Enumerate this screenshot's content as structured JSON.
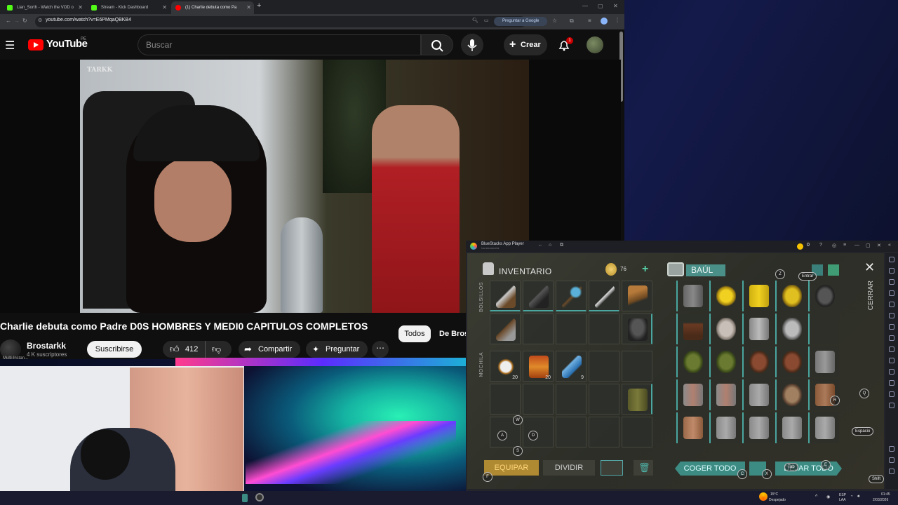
{
  "browser": {
    "tabs": [
      {
        "title": "Lian_Sorth - Watch the VOD o",
        "color": "#53fc18"
      },
      {
        "title": "Stream - Kick Dashboard",
        "color": "#53fc18"
      },
      {
        "title": "(1) Charlie debuta como Pa",
        "color": "#ff0000"
      }
    ],
    "url": "youtube.com/watch?v=E6PMqaQBKB4",
    "gemini_label": "Preguntar a Google"
  },
  "youtube": {
    "logo_text": "YouTube",
    "region": "PE",
    "search_placeholder": "Buscar",
    "create_label": "Crear",
    "notif_count": "1",
    "video_watermark": "TARKK",
    "video_title": "Charlie debuta como Padre D0S HOMBRES Y MEDI0 CAPITULOS COMPLETOS",
    "chips": [
      "Todos",
      "De Brostarkk"
    ],
    "channel": "Brostarkk",
    "subscribers": "4 K suscriptores",
    "subscribe_label": "Suscribirse",
    "likes": "412",
    "share_label": "Compartir",
    "ask_label": "Preguntar",
    "multi_tag": "Multi-Instan..."
  },
  "bluestacks": {
    "title": "BlueStacks App Player",
    "subtitle": "5.22.100.1001 P64",
    "coins": "0",
    "inventory_label": "INVENTARIO",
    "money": "76",
    "pockets_label": "BOLSILLOS",
    "backpack_label": "MOCHILA",
    "chest_label": "BAÚL",
    "close_label": "CERRAR",
    "equip_label": "EQUIPAR",
    "divide_label": "DIVIDIR",
    "take_all_label": "COGER TODO",
    "drop_all_label": "DEJAR TODO",
    "counts": {
      "c1": "20",
      "c2": "20",
      "c3": "9"
    },
    "keys": {
      "z": "Z",
      "enter": "Entrar",
      "q": "Q",
      "r": "R",
      "w": "W",
      "a": "A",
      "d": "D",
      "s": "S",
      "f": "F",
      "c": "C",
      "x": "X",
      "tab": "Tab",
      "e": "E",
      "space": "Espacio",
      "shift": "Shift"
    }
  },
  "taskbar": {
    "weather_temp": "15°C",
    "weather_desc": "Despejado",
    "lang": "ESP",
    "lang2": "LAA",
    "time": "01:45",
    "date": "2/03/2026"
  }
}
